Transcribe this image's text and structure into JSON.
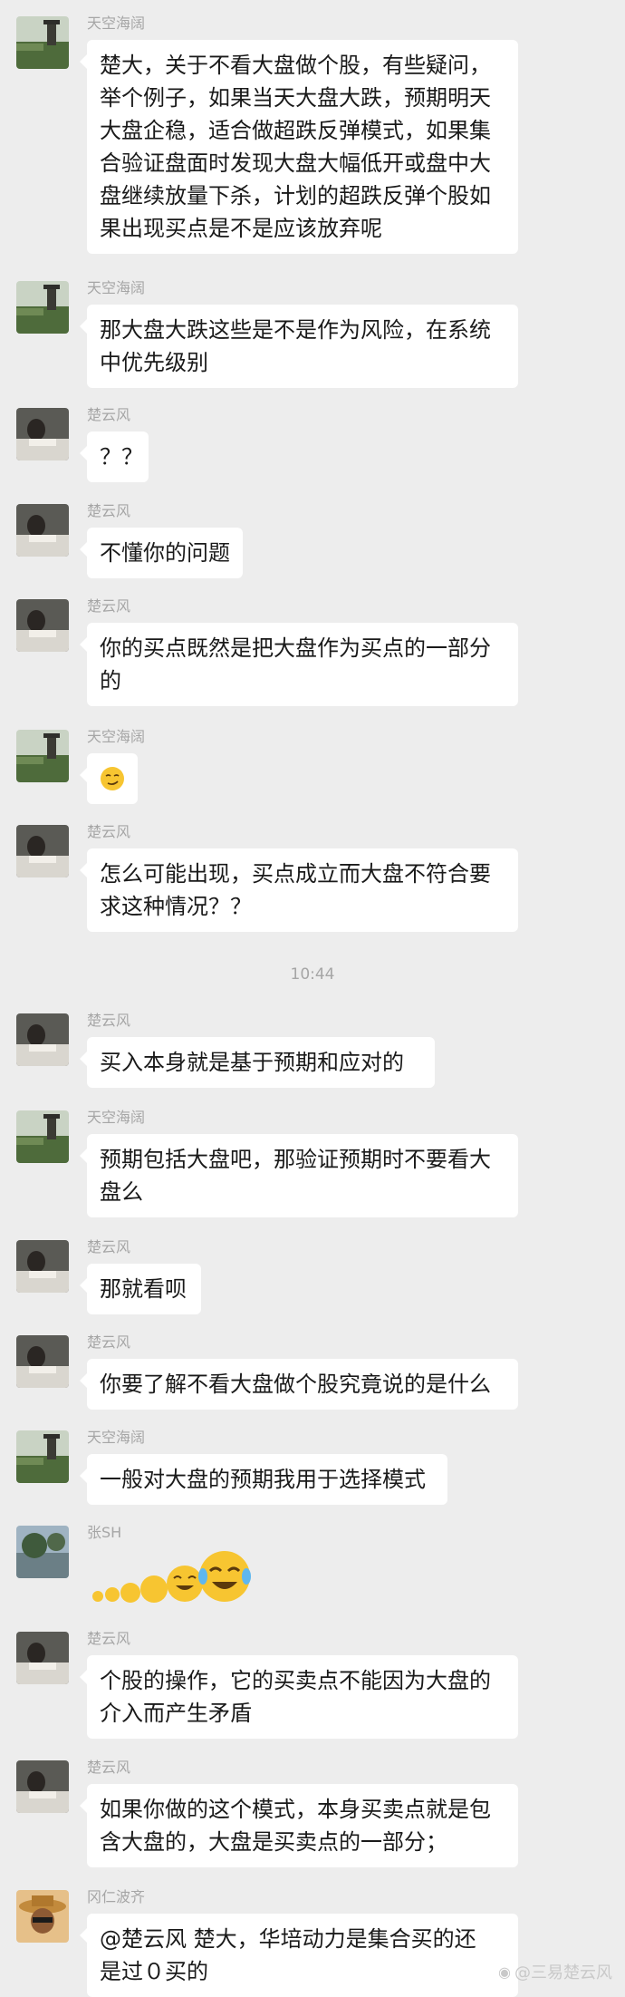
{
  "messages": [
    {
      "sender": "天空海阔",
      "avatar": "landscape-avatar",
      "text": "楚大，关于不看大盘做个股，有些疑问，\n举个例子，如果当天大盘大跌，预期明天\n大盘企稳，适合做超跌反弹模式，如果集\n合验证盘面时发现大盘大幅低开或盘中大\n盘继续放量下杀，计划的超跌反弹个股如\n果出现买点是不是应该放弃呢"
    },
    {
      "sender": "天空海阔",
      "avatar": "landscape-avatar",
      "text": "那大盘大跌这些是不是作为风险，在系统\n中优先级别"
    },
    {
      "sender": "楚云风",
      "avatar": "person-avatar",
      "text": "？？"
    },
    {
      "sender": "楚云风",
      "avatar": "person-avatar",
      "text": "不懂你的问题"
    },
    {
      "sender": "楚云风",
      "avatar": "person-avatar",
      "text": "你的买点既然是把大盘作为买点的一部分\n的"
    },
    {
      "sender": "天空海阔",
      "avatar": "landscape-avatar",
      "emoji": "smirk-emoji"
    },
    {
      "sender": "楚云风",
      "avatar": "person-avatar",
      "text": "怎么可能出现，买点成立而大盘不符合要\n求这种情况？？"
    },
    {
      "sender": "楚云风",
      "avatar": "person-avatar",
      "text": "买入本身就是基于预期和应对的"
    },
    {
      "sender": "天空海阔",
      "avatar": "landscape-avatar",
      "text": "预期包括大盘吧，那验证预期时不要看大\n盘么"
    },
    {
      "sender": "楚云风",
      "avatar": "person-avatar",
      "text": "那就看呗"
    },
    {
      "sender": "楚云风",
      "avatar": "person-avatar",
      "text": "你要了解不看大盘做个股究竟说的是什么"
    },
    {
      "sender": "天空海阔",
      "avatar": "landscape-avatar",
      "text": "一般对大盘的预期我用于选择模式"
    },
    {
      "sender": "张SH",
      "avatar": "lake-avatar",
      "sticker": "crying-laughing-sticker"
    },
    {
      "sender": "楚云风",
      "avatar": "person-avatar",
      "text": "个股的操作，它的买卖点不能因为大盘的\n介入而产生矛盾"
    },
    {
      "sender": "楚云风",
      "avatar": "person-avatar",
      "text": "如果你做的这个模式，本身买卖点就是包\n含大盘的，大盘是买卖点的一部分；"
    },
    {
      "sender": "冈仁波齐",
      "avatar": "hat-man-avatar",
      "text": "@楚云风 楚大，华培动力是集合买的还\n是过０买的"
    }
  ],
  "timestamp": "10:44",
  "watermark": "@三易楚云风",
  "colors": {
    "background": "#ededed",
    "bubble": "#ffffff",
    "meta_text": "#a6a6a6"
  }
}
